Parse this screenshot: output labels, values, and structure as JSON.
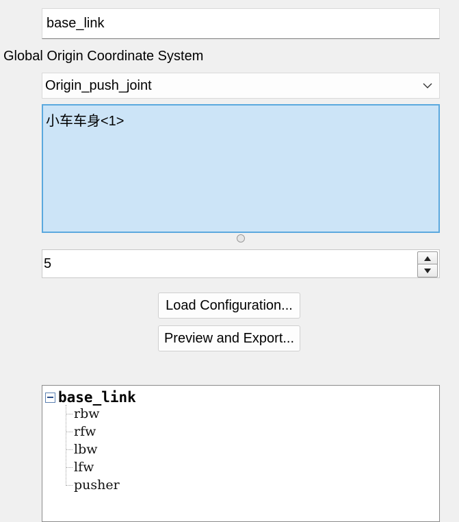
{
  "name_field": {
    "value": "base_link"
  },
  "origin_section": {
    "label": "Global Origin Coordinate System"
  },
  "origin_dropdown": {
    "selected": "Origin_push_joint"
  },
  "component_list": {
    "items": [
      "小车车身<1>"
    ]
  },
  "count_spinner": {
    "value": "5"
  },
  "buttons": {
    "load": "Load Configuration...",
    "preview": "Preview and Export..."
  },
  "tree": {
    "root": "base_link",
    "children": [
      "rbw",
      "rfw",
      "lbw",
      "lfw",
      "pusher"
    ]
  },
  "colors": {
    "selection": "#cce4f7",
    "selection_border": "#5aa8de",
    "background": "#f0f0f0"
  }
}
